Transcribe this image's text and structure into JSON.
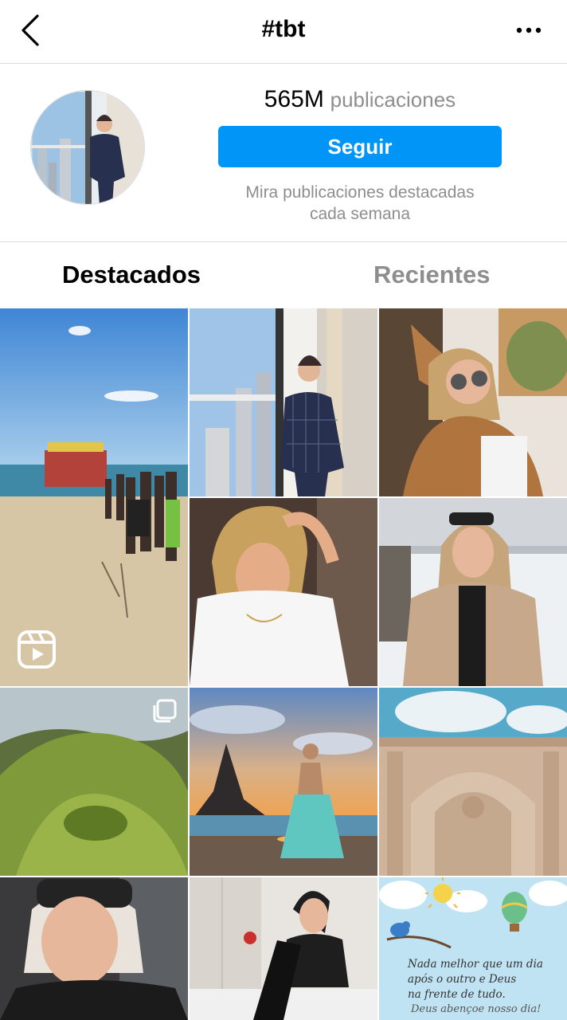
{
  "header": {
    "back_icon": "chevron-left-icon",
    "title": "#tbt",
    "more_icon": "more-horizontal-icon"
  },
  "profile": {
    "post_count": "565M",
    "post_label": "publicaciones",
    "follow_label": "Seguir",
    "hint_line1": "Mira publicaciones destacadas",
    "hint_line2": "cada semana"
  },
  "tabs": [
    {
      "label": "Destacados",
      "active": true
    },
    {
      "label": "Recientes",
      "active": false
    }
  ],
  "grid": {
    "posts": [
      {
        "subject": "beach-scene",
        "badge": "reels-icon"
      },
      {
        "subject": "woman-at-window",
        "badge": ""
      },
      {
        "subject": "woman-sunglasses-tree",
        "badge": ""
      },
      {
        "subject": "woman-white-tshirt",
        "badge": ""
      },
      {
        "subject": "woman-coat-snow",
        "badge": ""
      },
      {
        "subject": "green-hills",
        "badge": "carousel-icon"
      },
      {
        "subject": "woman-sunset-beach",
        "badge": ""
      },
      {
        "subject": "stone-arch",
        "badge": ""
      },
      {
        "subject": "woman-cap-car",
        "badge": ""
      },
      {
        "subject": "woman-black-boots",
        "badge": ""
      },
      {
        "subject": "quote-card",
        "badge": ""
      }
    ],
    "quote_card": {
      "line1": "Nada melhor que um dia",
      "line2": "após o outro e Deus",
      "line3": "na frente de tudo.",
      "signature": "Deus abençoe nosso dia!"
    }
  },
  "colors": {
    "accent": "#0095f6",
    "muted_text": "#8e8e8e",
    "divider": "#dbdbdb"
  }
}
